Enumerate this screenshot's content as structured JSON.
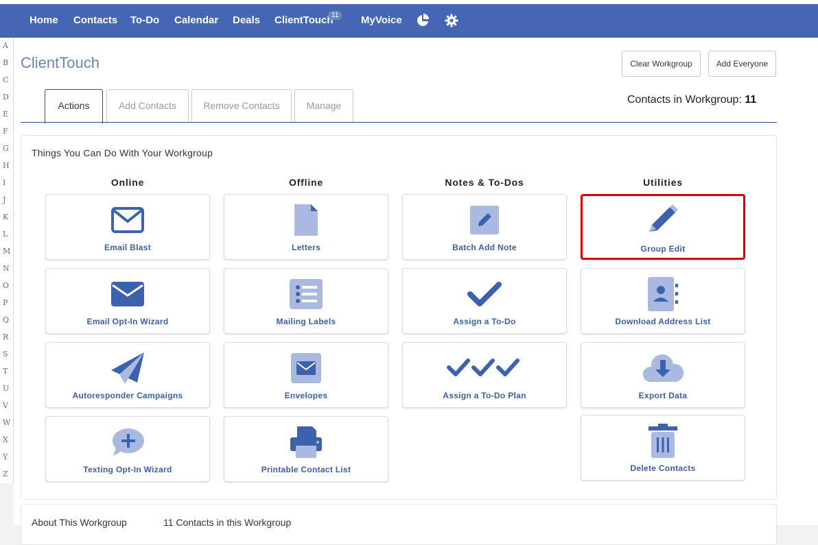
{
  "nav": {
    "items": [
      "Home",
      "Contacts",
      "To-Do",
      "Calendar",
      "Deals",
      "ClientTouch",
      "MyVoice"
    ],
    "badge": "11"
  },
  "alphabet": [
    "A",
    "B",
    "C",
    "D",
    "E",
    "F",
    "G",
    "H",
    "I",
    "J",
    "K",
    "L",
    "M",
    "N",
    "O",
    "P",
    "Q",
    "R",
    "S",
    "T",
    "U",
    "V",
    "W",
    "X",
    "Y",
    "Z"
  ],
  "page": {
    "title": "ClientTouch",
    "clear_workgroup": "Clear Workgroup",
    "add_everyone": "Add Everyone",
    "count_label": "Contacts in Workgroup:",
    "count_value": "11"
  },
  "tabs": [
    "Actions",
    "Add Contacts",
    "Remove Contacts",
    "Manage"
  ],
  "panel": {
    "title": "Things You Can Do With Your Workgroup",
    "columns": [
      "Online",
      "Offline",
      "Notes & To-Dos",
      "Utilities"
    ],
    "cards": {
      "email_blast": "Email Blast",
      "letters": "Letters",
      "batch_add_note": "Batch Add Note",
      "group_edit": "Group Edit",
      "email_optin": "Email Opt-In Wizard",
      "mailing_labels": "Mailing Labels",
      "assign_todo": "Assign a To-Do",
      "download_address": "Download Address List",
      "autoresponder": "Autoresponder Campaigns",
      "envelopes": "Envelopes",
      "assign_todo_plan": "Assign a To-Do Plan",
      "export_data": "Export Data",
      "texting_optin": "Texting Opt-In Wizard",
      "printable_list": "Printable Contact List",
      "delete_contacts": "Delete Contacts"
    }
  },
  "about": {
    "label": "About This Workgroup",
    "count_text": "11 Contacts in this Workgroup"
  },
  "colors": {
    "nav": "#4466b4",
    "primary_icon": "#3d62ad",
    "light_icon": "#a9b9e0",
    "highlight": "#d40000"
  }
}
